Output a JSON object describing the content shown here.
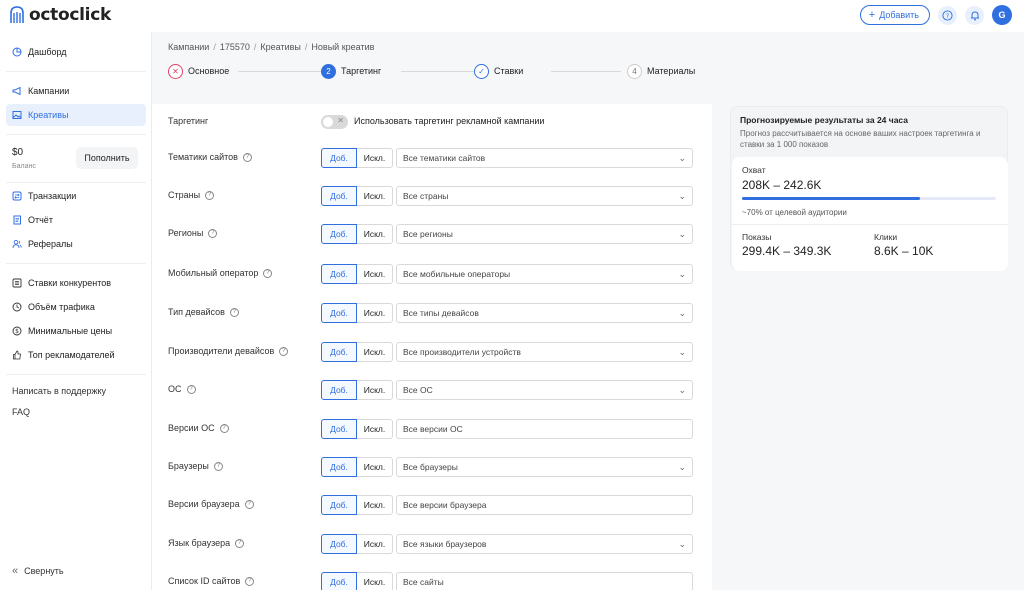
{
  "header": {
    "logo_text": "octoclick",
    "add_label": "Добавить",
    "avatar_initial": "G"
  },
  "sidebar": {
    "items_top": [
      {
        "label": "Дашборд",
        "icon": "pie-icon"
      }
    ],
    "items_group1": [
      {
        "label": "Кампании",
        "icon": "megaphone-icon"
      },
      {
        "label": "Креативы",
        "icon": "image-icon",
        "active": true
      }
    ],
    "balance": {
      "amount": "$0",
      "label": "Баланс",
      "topup_label": "Пополнить"
    },
    "items_group2": [
      {
        "label": "Транзакции",
        "icon": "exchange-icon"
      },
      {
        "label": "Отчёт",
        "icon": "report-icon"
      },
      {
        "label": "Рефералы",
        "icon": "users-icon"
      }
    ],
    "items_group3": [
      {
        "label": "Ставки конкурентов",
        "icon": "list-icon"
      },
      {
        "label": "Объём трафика",
        "icon": "clock-icon"
      },
      {
        "label": "Минимальные цены",
        "icon": "dollar-icon"
      },
      {
        "label": "Топ рекламодателей",
        "icon": "thumb-icon"
      }
    ],
    "support_label": "Написать в поддержку",
    "faq_label": "FAQ",
    "collapse_label": "Свернуть"
  },
  "breadcrumb": [
    "Кампании",
    "175570",
    "Креативы",
    "Новый креатив"
  ],
  "steps": [
    {
      "label": "Основное",
      "state": "error",
      "glyph": "✕"
    },
    {
      "label": "Таргетинг",
      "state": "active",
      "glyph": "2"
    },
    {
      "label": "Ставки",
      "state": "done",
      "glyph": "✓"
    },
    {
      "label": "Материалы",
      "state": "pending",
      "glyph": "4"
    }
  ],
  "form": {
    "toggle_row": {
      "label": "Таргетинг",
      "toggle_text": "Использовать таргетинг рекламной кампании"
    },
    "include_label": "Доб.",
    "exclude_label": "Искл.",
    "rows": [
      {
        "label": "Тематики сайтов",
        "value": "Все тематики сайтов",
        "dropdown": true
      },
      {
        "label": "Страны",
        "value": "Все страны",
        "dropdown": true
      },
      {
        "label": "Регионы",
        "value": "Все регионы",
        "dropdown": true
      },
      {
        "label": "Мобильный оператор",
        "value": "Все мобильные операторы",
        "dropdown": true
      },
      {
        "label": "Тип девайсов",
        "value": "Все типы девайсов",
        "dropdown": true
      },
      {
        "label": "Производители девайсов",
        "value": "Все производители устройств",
        "dropdown": true
      },
      {
        "label": "ОС",
        "value": "Все ОС",
        "dropdown": true
      },
      {
        "label": "Версии ОС",
        "value": "Все версии ОС",
        "dropdown": false
      },
      {
        "label": "Браузеры",
        "value": "Все браузеры",
        "dropdown": true
      },
      {
        "label": "Версии браузера",
        "value": "Все версии браузера",
        "dropdown": false
      },
      {
        "label": "Язык браузера",
        "value": "Все языки браузеров",
        "dropdown": true
      },
      {
        "label": "Список ID сайтов",
        "value": "Все сайты",
        "dropdown": false
      }
    ]
  },
  "forecast": {
    "title": "Прогнозируемые результаты за 24 часа",
    "subtitle": "Прогноз рассчитывается на основе ваших настроек таргетинга и ставки за 1 000 показов",
    "coverage_label": "Охват",
    "coverage_value": "208K – 242.6K",
    "coverage_fraction": 0.7,
    "coverage_note": "~70% от целевой аудитории",
    "impressions_label": "Показы",
    "impressions_value": "299.4K – 349.3K",
    "clicks_label": "Клики",
    "clicks_value": "8.6K – 10K"
  },
  "colors": {
    "accent": "#2f6fe0",
    "error": "#e0456b"
  }
}
